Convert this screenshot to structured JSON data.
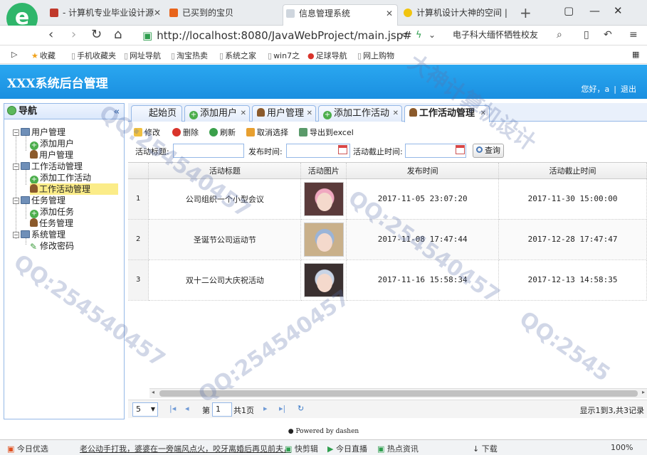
{
  "browser": {
    "tabs": [
      {
        "label": "- 计算机专业毕业设计源",
        "fav_color": "#c0392b"
      },
      {
        "label": "已买到的宝贝",
        "fav_color": "#e8641b"
      },
      {
        "label": "信息管理系统",
        "fav_color": "#cfd6de"
      },
      {
        "label": "计算机设计大神的空间 |",
        "fav_color": "#f1c40f"
      }
    ],
    "close_glyph": "✕",
    "new_tab_glyph": "+",
    "address": "http://localhost:8080/JavaWebProject/main.jsp#",
    "search_hint": "电子科大缅怀牺牲校友",
    "bookmarks": [
      "收藏",
      "手机收藏夹",
      "网址导航",
      "淘宝热卖",
      "系统之家",
      "win7之",
      "足球导航",
      "网上购物"
    ]
  },
  "app": {
    "title": "XXX系统后台管理",
    "greeting": "您好，a",
    "separator": "|",
    "logout": "退出"
  },
  "nav": {
    "title": "导航",
    "collapse_glyph": "«",
    "groups": [
      {
        "label": "用户管理",
        "items": [
          "添加用户",
          "用户管理"
        ]
      },
      {
        "label": "工作活动管理",
        "items": [
          "添加工作活动",
          "工作活动管理"
        ]
      },
      {
        "label": "任务管理",
        "items": [
          "添加任务",
          "任务管理"
        ]
      },
      {
        "label": "系统管理",
        "items": [
          "修改密码"
        ]
      }
    ]
  },
  "tabs": [
    {
      "label": "起始页"
    },
    {
      "label": "添加用户"
    },
    {
      "label": "用户管理"
    },
    {
      "label": "添加工作活动"
    },
    {
      "label": "工作活动管理"
    }
  ],
  "toolbar": {
    "edit": "修改",
    "delete": "删除",
    "refresh": "刷新",
    "deselect": "取消选择",
    "export": "导出到excel"
  },
  "search": {
    "title_label": "活动标题:",
    "publish_label": "发布时间:",
    "deadline_label": "活动截止时间:",
    "query_label": "查询"
  },
  "grid": {
    "columns": [
      "活动标题",
      "活动图片",
      "发布时间",
      "活动截止时间"
    ],
    "rows": [
      {
        "n": "1",
        "title": "公司组织一个小型会议",
        "publish": "2017-11-05 23:07:20",
        "deadline": "2017-11-30 15:00:00",
        "hair": "#5a3a3a",
        "bg": "#f0a8c0"
      },
      {
        "n": "2",
        "title": "圣诞节公司运动节",
        "publish": "2017-11-08 17:47:44",
        "deadline": "2017-12-28 17:47:47",
        "hair": "#c9b08a",
        "bg": "#9ab4d8"
      },
      {
        "n": "3",
        "title": "双十二公司大庆祝活动",
        "publish": "2017-11-16 15:58:34",
        "deadline": "2017-12-13 14:58:35",
        "hair": "#3a3030",
        "bg": "#c8d4e6"
      }
    ]
  },
  "pager": {
    "page_size": "5",
    "page_label_pre": "第",
    "page_value": "1",
    "page_label_post": "共1页",
    "summary": "显示1到3,共3记录"
  },
  "footer": "Powered by dashen",
  "status": {
    "left": "今日优选",
    "news": "老公动手打我，婆婆在一旁端风点火，咬牙离婚后再见前夫，",
    "items": [
      "快剪辑",
      "今日直播",
      "热点资讯",
      "下载",
      "100%"
    ]
  }
}
